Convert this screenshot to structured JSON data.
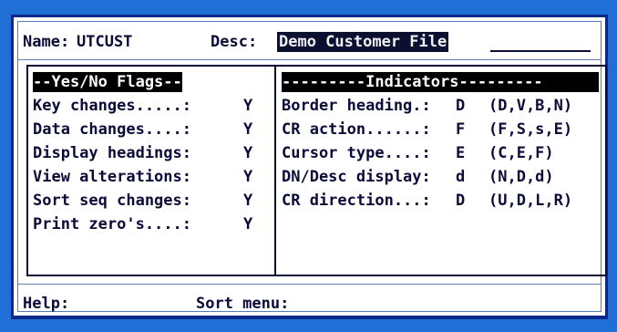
{
  "top": {
    "name_label": "Name:",
    "name_value": "UTCUST",
    "desc_label": "Desc:",
    "desc_value": "Demo Customer File"
  },
  "flags": {
    "header": "--Yes/No Flags--",
    "rows": [
      {
        "label": "Key changes.....:",
        "value": "Y"
      },
      {
        "label": "Data changes....:",
        "value": "Y"
      },
      {
        "label": "Display headings:",
        "value": "Y"
      },
      {
        "label": "View alterations:",
        "value": "Y"
      },
      {
        "label": "Sort seq changes:",
        "value": "Y"
      },
      {
        "label": "Print zero's....:",
        "value": "Y"
      }
    ]
  },
  "indicators": {
    "header": "---------Indicators---------",
    "rows": [
      {
        "label": "Border heading.:",
        "value": "D",
        "options": "(D,V,B,N)"
      },
      {
        "label": "CR action......:",
        "value": "F",
        "options": "(F,S,s,E)"
      },
      {
        "label": "Cursor type....:",
        "value": "E",
        "options": "(C,E,F)"
      },
      {
        "label": "DN/Desc display:",
        "value": "d",
        "options": "(N,D,d)"
      },
      {
        "label": "CR direction...:",
        "value": "D",
        "options": "(U,D,L,R)"
      }
    ]
  },
  "bottom": {
    "help_label": "Help:",
    "sort_label": "Sort menu:"
  }
}
